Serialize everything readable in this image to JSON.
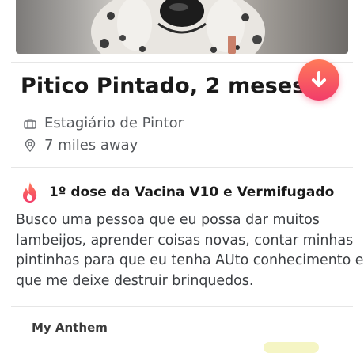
{
  "profile": {
    "name_age": "Pitico Pintado, 2 meses",
    "job": "Estagiário de Pintor",
    "distance": "7 miles away"
  },
  "passion": {
    "text": "1º dose da Vacina V10 e Vermifugado"
  },
  "bio": {
    "lines": [
      "Busco uma pessoa que eu possa dar muitos",
      "lambeijos, aprender coisas novas, contar minhas",
      "pintinhas para que eu tenha AUto conhecimento e",
      "que me deixe destruir brinquedos."
    ]
  },
  "anthem": {
    "title": "My Anthem"
  },
  "icons": {
    "action_button": "arrow-down-icon",
    "job": "briefcase-icon",
    "distance": "location-pin-icon",
    "passion": "flame-icon"
  },
  "colors": {
    "accent_start": "#ff7a59",
    "accent_end": "#f23d6a",
    "text_primary": "#1a1a1a",
    "text_secondary": "#55585c"
  }
}
